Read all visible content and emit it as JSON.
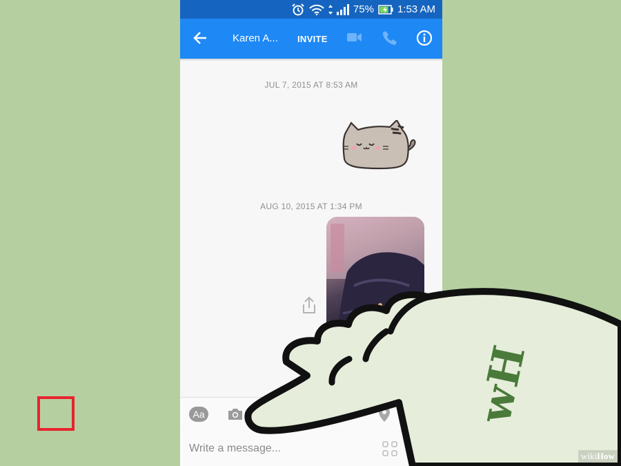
{
  "status_bar": {
    "battery": "75%",
    "time": "1:53 AM"
  },
  "header": {
    "contact_name": "Karen A...",
    "invite_label": "INVITE"
  },
  "conversation": {
    "timestamp_1": "JUL 7, 2015 AT 8:53 AM",
    "timestamp_2": "AUG 10, 2015 AT 1:34 PM"
  },
  "toolbar": {
    "text_toggle": "Aa"
  },
  "composer": {
    "placeholder": "Write a message..."
  },
  "watermark": {
    "brand_prefix": "wiki",
    "brand_suffix": "How",
    "hand_mark": "wH"
  },
  "colors": {
    "header": "#1e88f5",
    "status_bar": "#1565c0",
    "highlight": "#e8232f",
    "background": "#b5cfa0"
  },
  "icons": [
    "back-arrow-icon",
    "video-call-icon",
    "phone-call-icon",
    "info-icon",
    "camera-icon",
    "gallery-icon",
    "emoji-icon",
    "microphone-icon",
    "location-icon",
    "more-icon",
    "share-icon",
    "qr-icon",
    "thumbs-up-icon"
  ]
}
